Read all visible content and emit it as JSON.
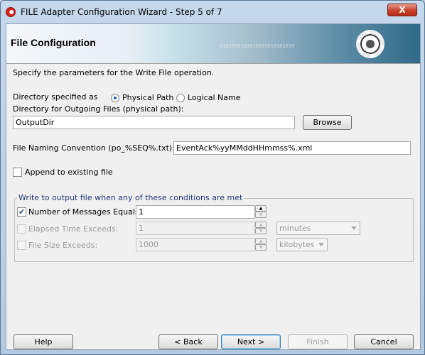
{
  "window": {
    "title": "FILE Adapter Configuration Wizard - Step 5 of 7",
    "close_label": "X"
  },
  "banner": {
    "title": "File Configuration",
    "binary_text": "0101010101010101010101010"
  },
  "intro": "Specify the parameters for the Write File operation.",
  "directory_type": {
    "label": "Directory specified as",
    "options": [
      {
        "label": "Physical Path",
        "selected": true
      },
      {
        "label": "Logical Name",
        "selected": false
      }
    ]
  },
  "directory": {
    "label": "Directory for Outgoing Files (physical path):",
    "value": "OutputDir",
    "browse_label": "Browse"
  },
  "naming": {
    "label": "File Naming Convention (po_%SEQ%.txt):",
    "value": "EventAck%yyMMddHHmmss%.xml"
  },
  "append": {
    "label": "Append to existing file",
    "checked": false
  },
  "conditions": {
    "legend": "Write to output file when any of these conditions are met",
    "rows": [
      {
        "label": "Number of Messages Equals:",
        "checked": true,
        "enabled": true,
        "value": "1"
      },
      {
        "label": "Elapsed Time Exceeds:",
        "checked": false,
        "enabled": false,
        "value": "1",
        "unit": "minutes"
      },
      {
        "label": "File Size Exceeds:",
        "checked": false,
        "enabled": false,
        "value": "1000",
        "unit": "kilobytes"
      }
    ]
  },
  "buttons": {
    "help": "Help",
    "back": "< Back",
    "next": "Next >",
    "finish": "Finish",
    "cancel": "Cancel"
  },
  "icons": {
    "logo": "oracle-logo-icon",
    "banner": "gear-plug-icon"
  }
}
